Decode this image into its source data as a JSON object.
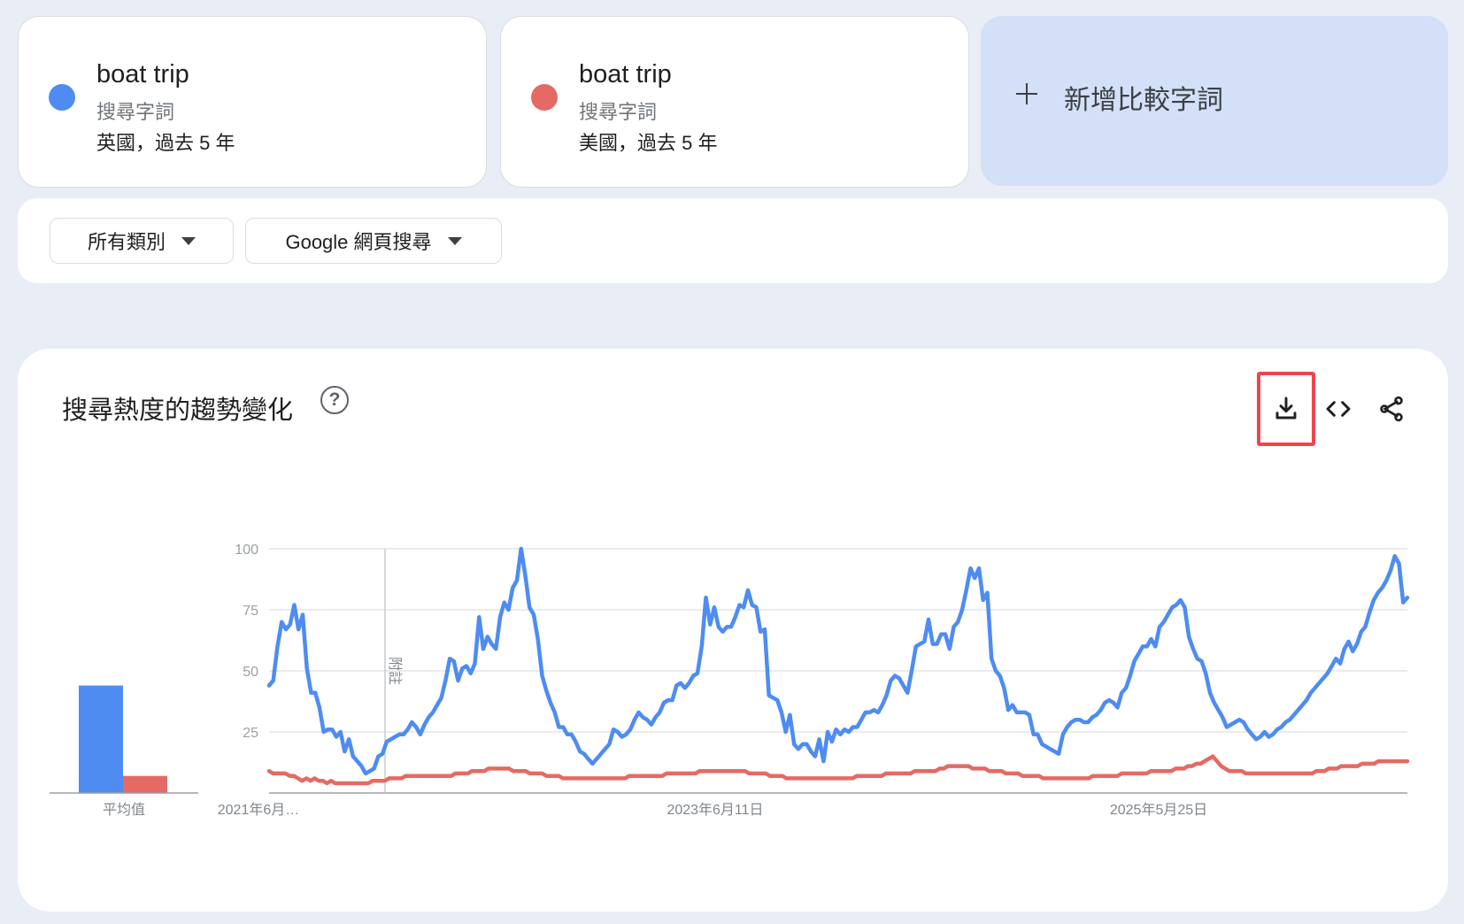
{
  "terms": [
    {
      "name": "boat trip",
      "kind": "搜尋字詞",
      "scope": "英國，過去 5 年",
      "color": "#4e8cf2"
    },
    {
      "name": "boat trip",
      "kind": "搜尋字詞",
      "scope": "美國，過去 5 年",
      "color": "#e46a63"
    }
  ],
  "add_compare_label": "新增比較字詞",
  "filters": {
    "category": "所有類別",
    "search_type": "Google 網頁搜尋"
  },
  "chart_panel": {
    "title": "搜尋熱度的趨勢變化",
    "help_icon": "?",
    "tools": [
      "download-icon",
      "embed-code-icon",
      "share-icon"
    ]
  },
  "chart_data": {
    "type": "line",
    "title": "搜尋熱度的趨勢變化",
    "ylim": [
      0,
      100
    ],
    "yticks": [
      25,
      50,
      75,
      100
    ],
    "xtick_labels": [
      "2021年6月…",
      "2023年6月11日",
      "2025年5月25日"
    ],
    "annotation": "附註",
    "averages_label": "平均值",
    "averages": [
      44,
      7
    ],
    "series": [
      {
        "color": "#4e8cf2",
        "values": [
          44,
          46,
          60,
          70,
          67,
          69,
          77,
          67,
          73,
          51,
          41,
          41,
          35,
          25,
          26,
          26,
          23,
          25,
          17,
          22,
          15,
          13,
          11,
          8,
          9,
          10,
          15,
          16,
          21,
          22,
          23,
          24,
          24,
          26,
          29,
          27,
          24,
          28,
          31,
          33,
          36,
          39,
          46,
          55,
          54,
          46,
          51,
          52,
          49,
          53,
          72,
          59,
          64,
          61,
          59,
          72,
          78,
          75,
          84,
          87,
          100,
          89,
          76,
          73,
          63,
          48,
          42,
          37,
          33,
          27,
          27,
          24,
          24,
          21,
          17,
          16,
          14,
          12,
          14,
          16,
          18,
          20,
          26,
          25,
          23,
          24,
          26,
          30,
          33,
          31,
          30,
          28,
          31,
          33,
          37,
          38,
          38,
          44,
          45,
          43,
          45,
          48,
          49,
          60,
          80,
          69,
          76,
          68,
          66,
          68,
          68,
          72,
          77,
          76,
          83,
          77,
          76,
          66,
          67,
          40,
          39,
          38,
          33,
          25,
          32,
          20,
          18,
          20,
          20,
          17,
          15,
          22,
          13,
          25,
          21,
          26,
          24,
          26,
          25,
          27,
          27,
          30,
          33,
          33,
          34,
          33,
          36,
          40,
          46,
          48,
          47,
          44,
          41,
          50,
          60,
          61,
          62,
          71,
          61,
          61,
          65,
          65,
          59,
          68,
          70,
          75,
          83,
          92,
          88,
          92,
          79,
          82,
          55,
          50,
          48,
          43,
          34,
          36,
          33,
          33,
          33,
          32,
          24,
          24,
          20,
          19,
          18,
          17,
          16,
          24,
          27,
          29,
          30,
          30,
          29,
          29,
          31,
          32,
          34,
          37,
          38,
          37,
          35,
          41,
          43,
          48,
          54,
          57,
          60,
          60,
          63,
          60,
          68,
          70,
          73,
          76,
          77,
          79,
          76,
          64,
          59,
          55,
          54,
          49,
          41,
          37,
          34,
          31,
          27,
          28,
          29,
          30,
          29,
          26,
          24,
          22,
          23,
          25,
          23,
          24,
          26,
          27,
          29,
          30,
          32,
          34,
          36,
          38,
          41,
          43,
          45,
          47,
          49,
          52,
          55,
          53,
          59,
          62,
          58,
          61,
          66,
          68,
          74,
          79,
          82,
          84,
          87,
          91,
          97,
          94,
          78,
          80
        ]
      },
      {
        "color": "#e46a63",
        "values": [
          9,
          8,
          8,
          8,
          8,
          7,
          7,
          6,
          5,
          6,
          5,
          6,
          5,
          5,
          4,
          5,
          4,
          4,
          4,
          4,
          4,
          4,
          4,
          4,
          4,
          5,
          5,
          5,
          5,
          6,
          6,
          6,
          6,
          7,
          7,
          7,
          7,
          7,
          7,
          7,
          7,
          7,
          7,
          7,
          7,
          8,
          8,
          8,
          8,
          9,
          9,
          9,
          9,
          10,
          10,
          10,
          10,
          10,
          10,
          9,
          9,
          9,
          9,
          8,
          8,
          8,
          8,
          7,
          7,
          7,
          7,
          6,
          6,
          6,
          6,
          6,
          6,
          6,
          6,
          6,
          6,
          6,
          6,
          6,
          6,
          6,
          6,
          7,
          7,
          7,
          7,
          7,
          7,
          7,
          7,
          7,
          8,
          8,
          8,
          8,
          8,
          8,
          8,
          8,
          9,
          9,
          9,
          9,
          9,
          9,
          9,
          9,
          9,
          9,
          9,
          9,
          8,
          8,
          8,
          8,
          8,
          7,
          7,
          7,
          7,
          6,
          6,
          6,
          6,
          6,
          6,
          6,
          6,
          6,
          6,
          6,
          6,
          6,
          6,
          6,
          6,
          6,
          7,
          7,
          7,
          7,
          7,
          7,
          7,
          8,
          8,
          8,
          8,
          8,
          8,
          8,
          9,
          9,
          9,
          9,
          9,
          9,
          10,
          10,
          11,
          11,
          11,
          11,
          11,
          11,
          10,
          10,
          10,
          10,
          9,
          9,
          9,
          9,
          8,
          8,
          8,
          8,
          7,
          7,
          7,
          7,
          7,
          6,
          6,
          6,
          6,
          6,
          6,
          6,
          6,
          6,
          6,
          6,
          6,
          7,
          7,
          7,
          7,
          7,
          7,
          7,
          8,
          8,
          8,
          8,
          8,
          8,
          8,
          9,
          9,
          9,
          9,
          9,
          9,
          10,
          10,
          10,
          11,
          11,
          12,
          12,
          13,
          14,
          15,
          13,
          11,
          10,
          9,
          9,
          9,
          9,
          8,
          8,
          8,
          8,
          8,
          8,
          8,
          8,
          8,
          8,
          8,
          8,
          8,
          8,
          8,
          8,
          8,
          9,
          9,
          9,
          10,
          10,
          10,
          11,
          11,
          11,
          11,
          11,
          12,
          12,
          12,
          12,
          13,
          13,
          13,
          13,
          13,
          13,
          13,
          13
        ]
      }
    ]
  }
}
